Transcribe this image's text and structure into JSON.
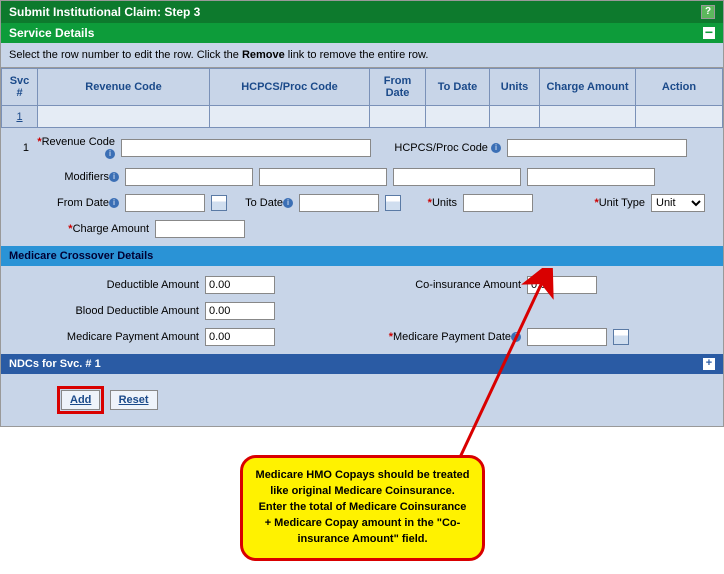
{
  "header": {
    "title": "Submit Institutional Claim: Step 3",
    "section": "Service Details"
  },
  "instruction_prefix": "Select the row number to edit the row. Click the ",
  "instruction_bold": "Remove",
  "instruction_suffix": " link to remove the entire row.",
  "columns": {
    "svc": "Svc #",
    "revenue": "Revenue Code",
    "hcpcs": "HCPCS/Proc Code",
    "from": "From Date",
    "to": "To Date",
    "units": "Units",
    "charge": "Charge Amount",
    "action": "Action"
  },
  "row1_svc": "1",
  "form": {
    "svc_num": "1",
    "revenue_label": "Revenue Code",
    "hcpcs_label": "HCPCS/Proc Code",
    "modifiers_label": "Modifiers",
    "from_label": "From Date",
    "to_label": "To Date",
    "units_label": "Units",
    "unit_type_label": "Unit Type",
    "unit_type_value": "Unit",
    "charge_label": "Charge Amount"
  },
  "crossover": {
    "header": "Medicare Crossover Details",
    "deductible_label": "Deductible Amount",
    "deductible_value": "0.00",
    "coinsurance_label": "Co-insurance Amount",
    "coinsurance_value": "0.00",
    "blood_label": "Blood Deductible Amount",
    "blood_value": "0.00",
    "medpay_label": "Medicare Payment Amount",
    "medpay_value": "0.00",
    "medpay_date_label": "Medicare Payment Date"
  },
  "ndc_header": "NDCs for Svc. # 1",
  "buttons": {
    "add": "Add",
    "reset": "Reset"
  },
  "callout_text": "Medicare HMO Copays should be treated like original Medicare Coinsurance. Enter the total of Medicare Coinsurance + Medicare Copay amount in the \"Co-insurance Amount\" field."
}
